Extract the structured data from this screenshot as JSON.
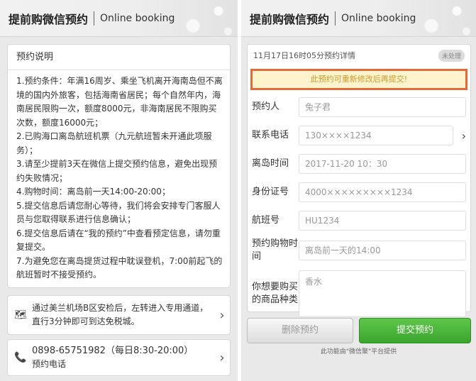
{
  "left": {
    "header": {
      "title_cn": "提前购微信预约",
      "title_en": "Online booking"
    },
    "notice": {
      "title": "预约说明",
      "rules": [
        "1.预约条件：年满16周岁、乘坐飞机离开海南岛但不离境的国内外旅客，包括海南省居民；每个自然年内，海南居民限购一次，额度8000元，非海南居民不限购买次数，额度16000元；",
        "2.已购海口离岛航班机票（九元航班暂未开通此项服务）；",
        "3.请至少提前3天在微信上提交预约信息，避免出现预约失败情况；",
        "4.购物时间：离岛前一天14:00-20:00；",
        "5.提交信息后请您耐心等待，我们将会安排专门客服人员与您取得联系进行信息确认；",
        "6.提交信息后请在“我的预约”中查看预定信息，请勿重复提交。",
        "7.为避免您在离岛提货过程中耽误登机，7:00前起飞的航班暂时不接受预约。"
      ]
    },
    "route": {
      "text": "通过美兰机场B区安检后，左转进入专用通道，直行3分钟即可到达免税城。"
    },
    "phone": {
      "number": "0898-65751982（每日8:30-20:00）",
      "label": "预约电话"
    }
  },
  "right": {
    "header": {
      "title_cn": "提前购微信预约",
      "title_en": "Online booking"
    },
    "detail_title": "11月17日16时05分预约详情",
    "badge": "未处理",
    "alert": "此预约可重新修改后再提交!",
    "fields": [
      {
        "label": "预约人",
        "value": "兔子君"
      },
      {
        "label": "联系电话",
        "value": "130××××1234"
      },
      {
        "label": "离岛时间",
        "value": "2017-11-20 10：30"
      },
      {
        "label": "身份证号",
        "value": "4000×××××××××1234"
      },
      {
        "label": "航班号",
        "value": "HU1234"
      },
      {
        "label": "预约购物时间",
        "value": "离岛前一天的14:00"
      },
      {
        "label": "你想要购买的商品种类",
        "value": "香水"
      }
    ],
    "buttons": {
      "delete": "删除预约",
      "submit": "提交预约"
    },
    "footer": "此功能由\"微信聚\"平台提供"
  },
  "icons": {
    "route": "map-icon",
    "phone": "phone-icon",
    "chevron": "chevron-right-icon"
  },
  "colors": {
    "submit_green": "#3aa52e",
    "alert_border": "#e56a3a",
    "alert_bg": "#fdf3cd"
  }
}
